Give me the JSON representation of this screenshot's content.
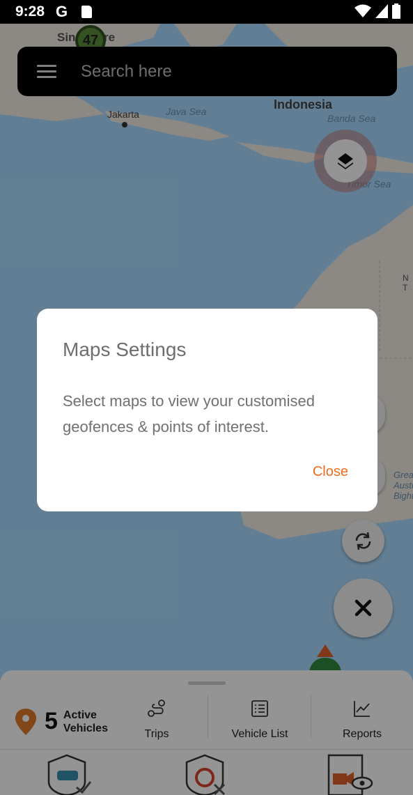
{
  "status_bar": {
    "time": "9:28",
    "g_badge": "G",
    "icons": [
      "wifi-icon",
      "signal-icon",
      "battery-icon"
    ]
  },
  "map": {
    "labels": {
      "singapore": "Singapore",
      "jakarta": "Jakarta",
      "java_sea": "Java Sea",
      "indonesia": "Indonesia",
      "banda_sea": "Banda Sea",
      "timor_sea": "Timor Sea",
      "great_australian_bight": "Great Australian Bight",
      "nt": "N T"
    },
    "cluster_count": "47",
    "colors": {
      "water": "#aadaff",
      "land": "#f1ede4"
    }
  },
  "search": {
    "placeholder": "Search here"
  },
  "dialog": {
    "title": "Maps Settings",
    "message": "Select maps to view your customised geofences & points of interest.",
    "close_label": "Close"
  },
  "bottom_sheet": {
    "active_count": "5",
    "active_label_line1": "Active",
    "active_label_line2": "Vehicles",
    "nav": {
      "trips": "Trips",
      "vehicle_list": "Vehicle List",
      "reports": "Reports"
    }
  },
  "colors": {
    "accent": "#f26b1d",
    "pin": "#e07b2c"
  }
}
